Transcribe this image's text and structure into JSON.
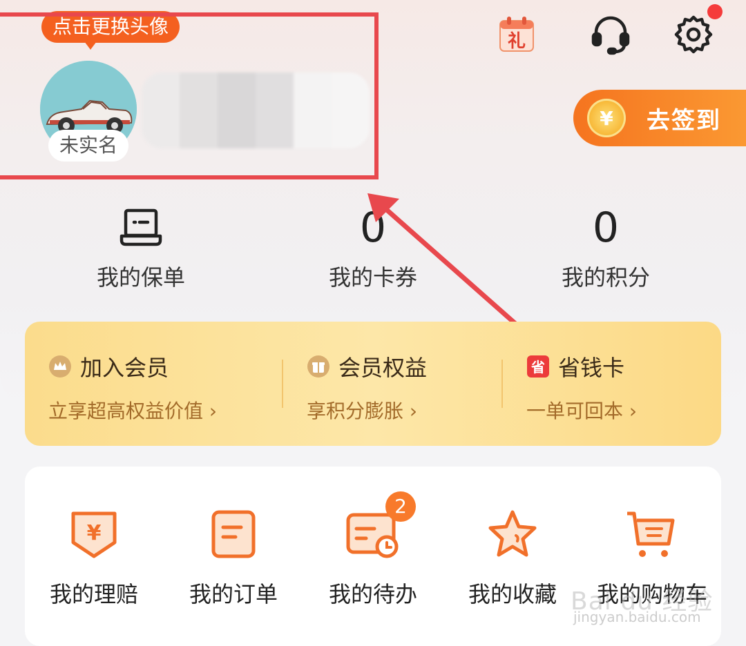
{
  "profile": {
    "tooltip": "点击更换头像",
    "realname_status": "未实名"
  },
  "signin": {
    "coin_symbol": "¥",
    "label": "去签到"
  },
  "gift_icon_char": "礼",
  "stats": [
    {
      "value": "",
      "label": "我的保单"
    },
    {
      "value": "0",
      "label": "我的卡券"
    },
    {
      "value": "0",
      "label": "我的积分"
    }
  ],
  "member": [
    {
      "title": "加入会员",
      "sub": "立享超高权益价值 ›",
      "icon": "crown-icon"
    },
    {
      "title": "会员权益",
      "sub": "享积分膨胀 ›",
      "icon": "gift-box-icon"
    },
    {
      "title": "省钱卡",
      "sub": "一单可回本 ›",
      "icon": "save-card-icon",
      "icon_text": "省"
    }
  ],
  "menu": [
    {
      "label": "我的理赔",
      "icon": "claim-icon"
    },
    {
      "label": "我的订单",
      "icon": "order-icon"
    },
    {
      "label": "我的待办",
      "icon": "todo-icon",
      "badge": "2"
    },
    {
      "label": "我的收藏",
      "icon": "star-icon"
    },
    {
      "label": "我的购物车",
      "icon": "cart-icon"
    }
  ],
  "watermark": {
    "main": "Bai du 经验",
    "sub": "jingyan.baidu.com"
  },
  "colors": {
    "accent": "#f4601f",
    "highlight": "#e8484d",
    "member_text": "#a36b2a"
  }
}
